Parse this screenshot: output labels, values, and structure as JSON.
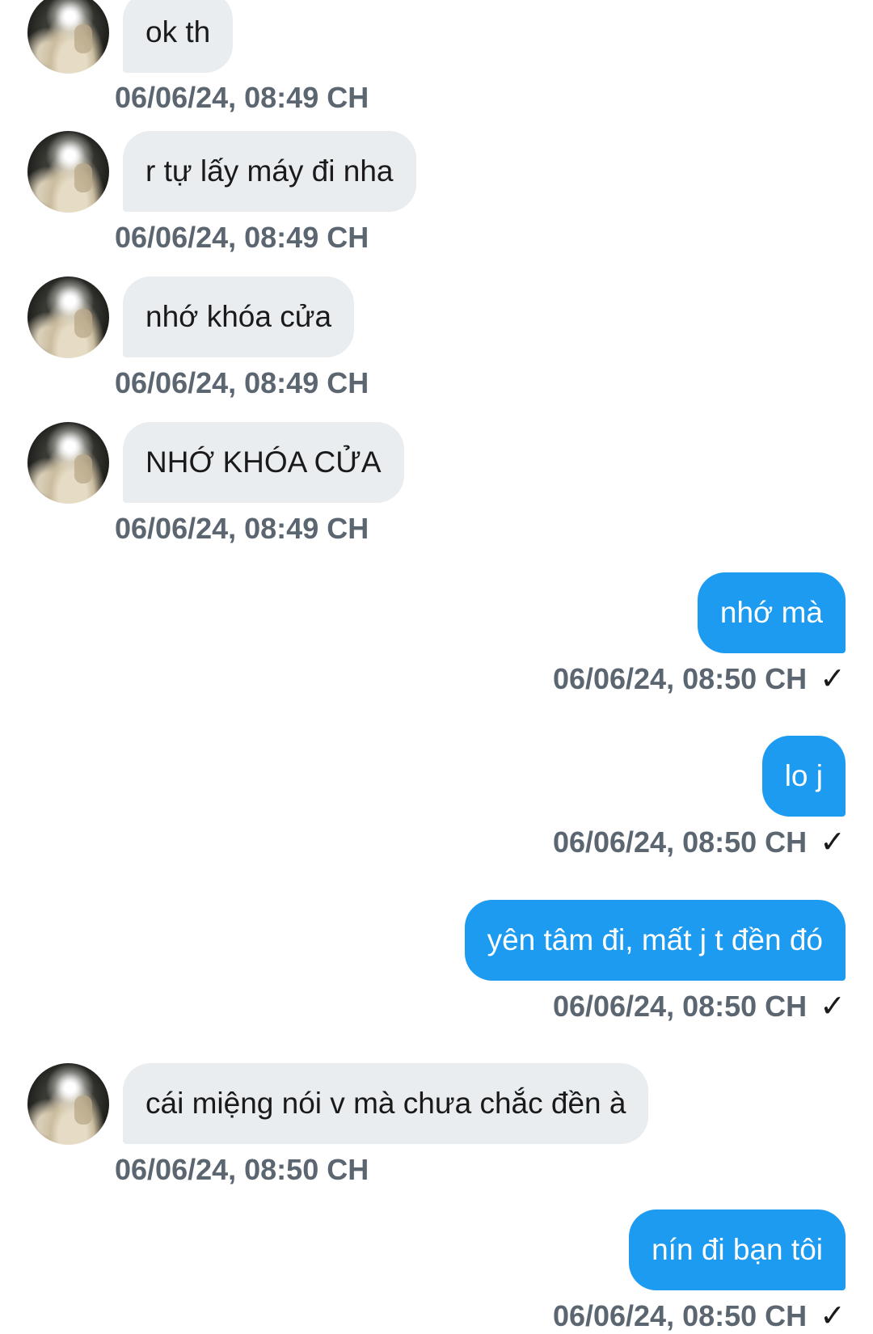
{
  "messages": [
    {
      "direction": "in",
      "text": "ok th",
      "timestamp": "06/06/24, 08:49 CH"
    },
    {
      "direction": "in",
      "text": "r tự lấy máy đi nha",
      "timestamp": "06/06/24, 08:49 CH"
    },
    {
      "direction": "in",
      "text": "nhớ khóa cửa",
      "timestamp": "06/06/24, 08:49 CH"
    },
    {
      "direction": "in",
      "text": "NHỚ KHÓA CỬA",
      "timestamp": "06/06/24, 08:49 CH"
    },
    {
      "direction": "out",
      "text": "nhớ mà",
      "timestamp": "06/06/24, 08:50 CH",
      "status_icon": "checkmark-icon"
    },
    {
      "direction": "out",
      "text": "lo j",
      "timestamp": "06/06/24, 08:50 CH",
      "status_icon": "checkmark-icon"
    },
    {
      "direction": "out",
      "text": "yên tâm đi, mất j t đền đó",
      "timestamp": "06/06/24, 08:50 CH",
      "status_icon": "checkmark-icon"
    },
    {
      "direction": "in",
      "text": "cái miệng nói v mà chưa chắc đền à",
      "timestamp": "06/06/24, 08:50 CH"
    },
    {
      "direction": "out",
      "text": "nín đi bạn tôi",
      "timestamp": "06/06/24, 08:50 CH",
      "status_icon": "checkmark-icon"
    }
  ],
  "colors": {
    "incoming_bubble": "#e9edf0",
    "outgoing_bubble": "#1d9bf0",
    "timestamp_text": "#5b6670",
    "background": "#ffffff"
  },
  "check_glyph": "✓"
}
